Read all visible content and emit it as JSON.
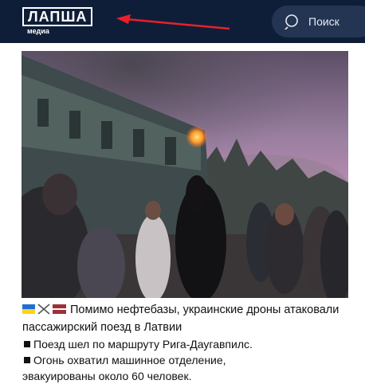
{
  "header": {
    "logo_text": "ЛАПША",
    "logo_sub": "медиа",
    "search_label": "Поиск",
    "search_icon": "search-icon"
  },
  "post": {
    "headline": "Помимо нефтебазы, украинские дроны атаковали пассажирский поезд в Латвии",
    "bullets": [
      "Поезд шел по маршруту Рига-Даугавпилс.",
      "Огонь охватил машинное отделение,",
      "эвакуированы около 60 человек."
    ],
    "flag_icons": [
      "ukraine-flag-icon",
      "crossed-swords-icon",
      "latvia-flag-icon"
    ]
  },
  "colors": {
    "header_bg": "#0f1e38",
    "search_bg": "#243553",
    "arrow": "#e8202a"
  }
}
